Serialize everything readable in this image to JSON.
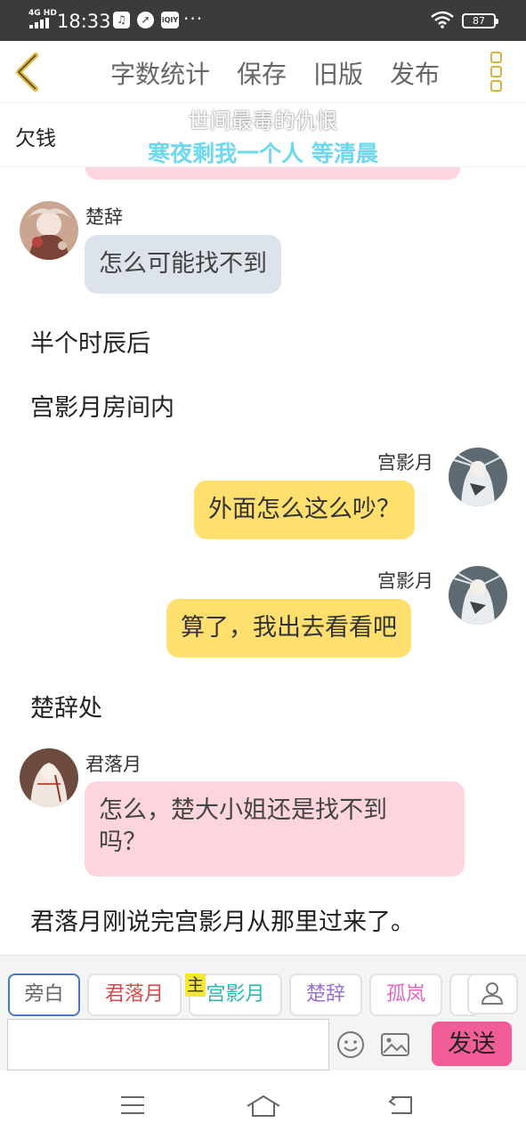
{
  "status_bar": {
    "network": "4G HD",
    "time": "18:33",
    "battery": "87"
  },
  "toolbar": {
    "items": [
      "字数统计",
      "保存",
      "旧版",
      "发布"
    ]
  },
  "title": "欠钱",
  "lyrics": {
    "line1": "世间最毒的仇恨",
    "line2": "寒夜剩我一个人 等清晨"
  },
  "messages": [
    {
      "speaker": "楚辞",
      "text": "怎么可能找不到"
    },
    {
      "narration": "半个时辰后"
    },
    {
      "narration": "宫影月房间内"
    },
    {
      "speaker": "宫影月",
      "text": "外面怎么这么吵？"
    },
    {
      "speaker": "宫影月",
      "text": "算了，我出去看看吧"
    },
    {
      "narration": "楚辞处"
    },
    {
      "speaker": "君落月",
      "text_line1": "怎么，楚大小姐还是找不到",
      "text_line2": "吗？"
    },
    {
      "narration": "君落月刚说完宫影月从那里过来了。"
    }
  ],
  "roles": [
    {
      "label": "旁白",
      "color": "#666666"
    },
    {
      "label": "君落月",
      "color": "#d84a4a"
    },
    {
      "label": "宫影月",
      "color": "#2bb7b0"
    },
    {
      "label": "楚辞",
      "color": "#9b6fd0"
    },
    {
      "label": "孤岚",
      "color": "#e466c0"
    }
  ],
  "main_tag": "主",
  "composer": {
    "placeholder": "",
    "send_label": "发送"
  },
  "colors": {
    "accent_gold": "#d9b23c",
    "send_pink": "#f35d97",
    "bubble_yellow": "#ffdf6e",
    "bubble_pink": "#fdd5de",
    "bubble_gray": "#dde3ea"
  }
}
